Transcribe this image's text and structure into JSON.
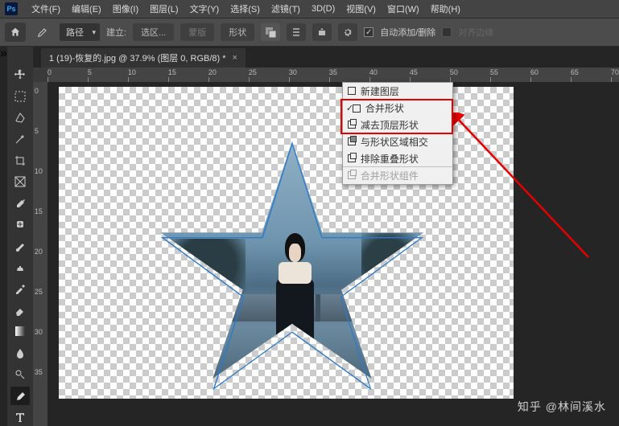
{
  "menubar": {
    "items": [
      "文件(F)",
      "编辑(E)",
      "图像(I)",
      "图层(L)",
      "文字(Y)",
      "选择(S)",
      "滤镜(T)",
      "3D(D)",
      "视图(V)",
      "窗口(W)",
      "帮助(H)"
    ]
  },
  "optionsbar": {
    "mode_label": "路径",
    "build_label": "建立:",
    "sel_btn": "选区...",
    "mask_btn": "蒙版",
    "shape_btn": "形状",
    "auto_add_label": "自动添加/删除",
    "align_edges_label": "对齐边缘"
  },
  "tab": {
    "title": "1 (19)-恢复的.jpg @ 37.9% (图层 0, RGB/8) *"
  },
  "ruler": {
    "h": [
      "0",
      "5",
      "10",
      "15",
      "20",
      "25",
      "30",
      "35",
      "40",
      "45",
      "50",
      "55",
      "60",
      "65",
      "70"
    ],
    "v": [
      "0",
      "5",
      "10",
      "15",
      "20",
      "25",
      "30",
      "35"
    ]
  },
  "dropdown": {
    "new_layer": "新建图层",
    "combine": "合并形状",
    "subtract": "减去顶层形状",
    "intersect": "与形状区域相交",
    "exclude": "排除重叠形状",
    "merge_components": "合并形状组件"
  },
  "watermark": "知乎 @林间溪水"
}
